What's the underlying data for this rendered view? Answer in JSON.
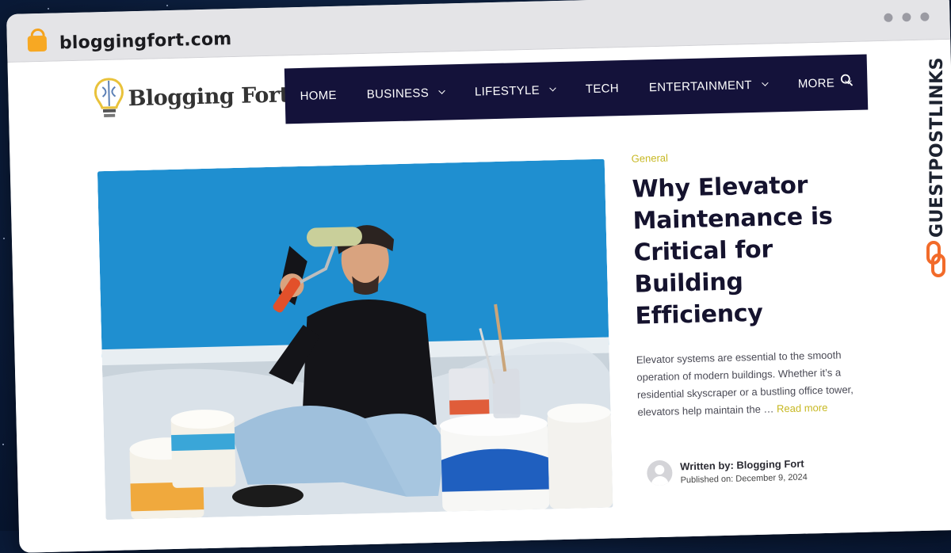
{
  "browser": {
    "url": "bloggingfort.com"
  },
  "site": {
    "logo_text": "Blogging Fort",
    "nav": [
      {
        "label": "HOME",
        "has_caret": false
      },
      {
        "label": "BUSINESS",
        "has_caret": true
      },
      {
        "label": "LIFESTYLE",
        "has_caret": true
      },
      {
        "label": "TECH",
        "has_caret": false
      },
      {
        "label": "ENTERTAINMENT",
        "has_caret": true
      },
      {
        "label": "MORE",
        "has_caret": true
      }
    ],
    "nav_color": "#14123a"
  },
  "post": {
    "category": "General",
    "title": "Why Elevator Maintenance is Critical for Building Efficiency",
    "excerpt": "Elevator systems are essential to the smooth operation of modern buildings. Whether it’s a residential skyscraper or a bustling office tower, elevators help maintain the …",
    "read_more": "Read more",
    "author_label": "Written by: Blogging Fort",
    "published": "Published on: December 9, 2024",
    "accent_color": "#c7b822"
  },
  "badge": {
    "text": "GUESTPOSTLINKS",
    "color": "#f26b2a"
  }
}
